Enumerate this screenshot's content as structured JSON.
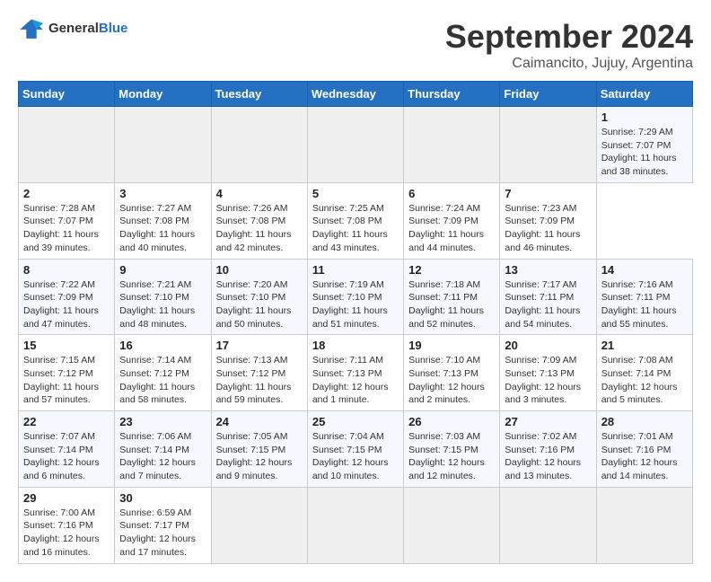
{
  "header": {
    "logo_text_general": "General",
    "logo_text_blue": "Blue",
    "title": "September 2024",
    "subtitle": "Caimancito, Jujuy, Argentina"
  },
  "calendar": {
    "days_of_week": [
      "Sunday",
      "Monday",
      "Tuesday",
      "Wednesday",
      "Thursday",
      "Friday",
      "Saturday"
    ],
    "weeks": [
      [
        {
          "day": "",
          "empty": true
        },
        {
          "day": "",
          "empty": true
        },
        {
          "day": "",
          "empty": true
        },
        {
          "day": "",
          "empty": true
        },
        {
          "day": "",
          "empty": true
        },
        {
          "day": "",
          "empty": true
        },
        {
          "day": "1",
          "sunrise": "Sunrise: 7:29 AM",
          "sunset": "Sunset: 7:07 PM",
          "daylight": "Daylight: 11 hours and 38 minutes."
        }
      ],
      [
        {
          "day": "2",
          "sunrise": "Sunrise: 7:28 AM",
          "sunset": "Sunset: 7:07 PM",
          "daylight": "Daylight: 11 hours and 39 minutes."
        },
        {
          "day": "3",
          "sunrise": "Sunrise: 7:27 AM",
          "sunset": "Sunset: 7:08 PM",
          "daylight": "Daylight: 11 hours and 40 minutes."
        },
        {
          "day": "4",
          "sunrise": "Sunrise: 7:26 AM",
          "sunset": "Sunset: 7:08 PM",
          "daylight": "Daylight: 11 hours and 42 minutes."
        },
        {
          "day": "5",
          "sunrise": "Sunrise: 7:25 AM",
          "sunset": "Sunset: 7:08 PM",
          "daylight": "Daylight: 11 hours and 43 minutes."
        },
        {
          "day": "6",
          "sunrise": "Sunrise: 7:24 AM",
          "sunset": "Sunset: 7:09 PM",
          "daylight": "Daylight: 11 hours and 44 minutes."
        },
        {
          "day": "7",
          "sunrise": "Sunrise: 7:23 AM",
          "sunset": "Sunset: 7:09 PM",
          "daylight": "Daylight: 11 hours and 46 minutes."
        }
      ],
      [
        {
          "day": "8",
          "sunrise": "Sunrise: 7:22 AM",
          "sunset": "Sunset: 7:09 PM",
          "daylight": "Daylight: 11 hours and 47 minutes."
        },
        {
          "day": "9",
          "sunrise": "Sunrise: 7:21 AM",
          "sunset": "Sunset: 7:10 PM",
          "daylight": "Daylight: 11 hours and 48 minutes."
        },
        {
          "day": "10",
          "sunrise": "Sunrise: 7:20 AM",
          "sunset": "Sunset: 7:10 PM",
          "daylight": "Daylight: 11 hours and 50 minutes."
        },
        {
          "day": "11",
          "sunrise": "Sunrise: 7:19 AM",
          "sunset": "Sunset: 7:10 PM",
          "daylight": "Daylight: 11 hours and 51 minutes."
        },
        {
          "day": "12",
          "sunrise": "Sunrise: 7:18 AM",
          "sunset": "Sunset: 7:11 PM",
          "daylight": "Daylight: 11 hours and 52 minutes."
        },
        {
          "day": "13",
          "sunrise": "Sunrise: 7:17 AM",
          "sunset": "Sunset: 7:11 PM",
          "daylight": "Daylight: 11 hours and 54 minutes."
        },
        {
          "day": "14",
          "sunrise": "Sunrise: 7:16 AM",
          "sunset": "Sunset: 7:11 PM",
          "daylight": "Daylight: 11 hours and 55 minutes."
        }
      ],
      [
        {
          "day": "15",
          "sunrise": "Sunrise: 7:15 AM",
          "sunset": "Sunset: 7:12 PM",
          "daylight": "Daylight: 11 hours and 57 minutes."
        },
        {
          "day": "16",
          "sunrise": "Sunrise: 7:14 AM",
          "sunset": "Sunset: 7:12 PM",
          "daylight": "Daylight: 11 hours and 58 minutes."
        },
        {
          "day": "17",
          "sunrise": "Sunrise: 7:13 AM",
          "sunset": "Sunset: 7:12 PM",
          "daylight": "Daylight: 11 hours and 59 minutes."
        },
        {
          "day": "18",
          "sunrise": "Sunrise: 7:11 AM",
          "sunset": "Sunset: 7:13 PM",
          "daylight": "Daylight: 12 hours and 1 minute."
        },
        {
          "day": "19",
          "sunrise": "Sunrise: 7:10 AM",
          "sunset": "Sunset: 7:13 PM",
          "daylight": "Daylight: 12 hours and 2 minutes."
        },
        {
          "day": "20",
          "sunrise": "Sunrise: 7:09 AM",
          "sunset": "Sunset: 7:13 PM",
          "daylight": "Daylight: 12 hours and 3 minutes."
        },
        {
          "day": "21",
          "sunrise": "Sunrise: 7:08 AM",
          "sunset": "Sunset: 7:14 PM",
          "daylight": "Daylight: 12 hours and 5 minutes."
        }
      ],
      [
        {
          "day": "22",
          "sunrise": "Sunrise: 7:07 AM",
          "sunset": "Sunset: 7:14 PM",
          "daylight": "Daylight: 12 hours and 6 minutes."
        },
        {
          "day": "23",
          "sunrise": "Sunrise: 7:06 AM",
          "sunset": "Sunset: 7:14 PM",
          "daylight": "Daylight: 12 hours and 7 minutes."
        },
        {
          "day": "24",
          "sunrise": "Sunrise: 7:05 AM",
          "sunset": "Sunset: 7:15 PM",
          "daylight": "Daylight: 12 hours and 9 minutes."
        },
        {
          "day": "25",
          "sunrise": "Sunrise: 7:04 AM",
          "sunset": "Sunset: 7:15 PM",
          "daylight": "Daylight: 12 hours and 10 minutes."
        },
        {
          "day": "26",
          "sunrise": "Sunrise: 7:03 AM",
          "sunset": "Sunset: 7:15 PM",
          "daylight": "Daylight: 12 hours and 12 minutes."
        },
        {
          "day": "27",
          "sunrise": "Sunrise: 7:02 AM",
          "sunset": "Sunset: 7:16 PM",
          "daylight": "Daylight: 12 hours and 13 minutes."
        },
        {
          "day": "28",
          "sunrise": "Sunrise: 7:01 AM",
          "sunset": "Sunset: 7:16 PM",
          "daylight": "Daylight: 12 hours and 14 minutes."
        }
      ],
      [
        {
          "day": "29",
          "sunrise": "Sunrise: 7:00 AM",
          "sunset": "Sunset: 7:16 PM",
          "daylight": "Daylight: 12 hours and 16 minutes."
        },
        {
          "day": "30",
          "sunrise": "Sunrise: 6:59 AM",
          "sunset": "Sunset: 7:17 PM",
          "daylight": "Daylight: 12 hours and 17 minutes."
        },
        {
          "day": "",
          "empty": true
        },
        {
          "day": "",
          "empty": true
        },
        {
          "day": "",
          "empty": true
        },
        {
          "day": "",
          "empty": true
        },
        {
          "day": "",
          "empty": true
        }
      ]
    ]
  }
}
